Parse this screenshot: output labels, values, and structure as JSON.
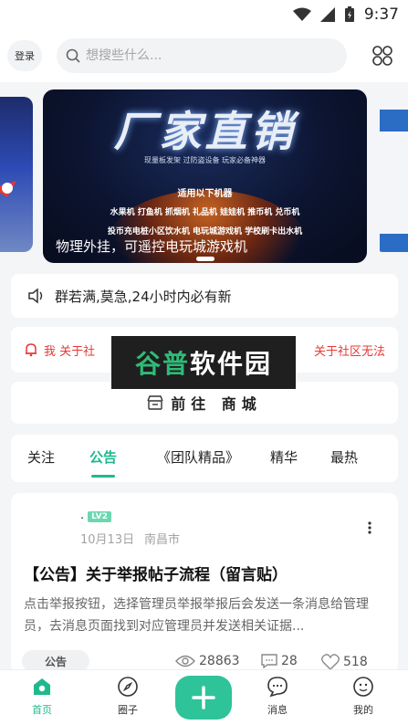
{
  "status_bar": {
    "time": "9:37"
  },
  "header": {
    "login_label": "登录",
    "search_placeholder": "想搜些什么..."
  },
  "banner": {
    "headline": "厂家直销",
    "tags": "现量板发架    过防盗设备    玩家必备神器",
    "grid_title": "适用以下机器",
    "grid_row1": "水果机  打鱼机  抓烟机  礼品机  娃娃机  推币机  兑币机",
    "grid_row2": "投币充电桩小区饮水机   电玩城游戏机   学校刷卡出水机",
    "caption": "物理外挂，可遥控电玩城游戏机"
  },
  "notice": {
    "text": "群若满,莫急,24小时内必有新"
  },
  "alert": {
    "text": "​​​​​​​​​​​​​​​​",
    "visible": "举报 关于社区无法...",
    "left_text": "我 关于社",
    "right_text": "关于社区无法"
  },
  "watermark": {
    "part1": "谷普",
    "part2": "软件园"
  },
  "mall": {
    "label": "前往 商城"
  },
  "tabs": [
    {
      "label": "关注"
    },
    {
      "label": "公告"
    },
    {
      "label": "《团队精品》"
    },
    {
      "label": "精华"
    },
    {
      "label": "最热"
    }
  ],
  "post": {
    "author": ".",
    "level": "LV2",
    "date": "10月13日",
    "location": "南昌市",
    "title": "【公告】关于举报帖子流程（留言贴）",
    "body": "点击举报按钮，选择管理员举报举报后会发送一条消息给管理员，去消息页面找到对应管理员并发送相关证据...",
    "tag": "公告",
    "views": "28863",
    "comments": "28",
    "likes": "518"
  },
  "bottom_nav": [
    {
      "label": "首页"
    },
    {
      "label": "圈子"
    },
    {
      "label": "消息"
    },
    {
      "label": "我的"
    }
  ],
  "colors": {
    "accent": "#1fb98e",
    "alert": "#e53935"
  }
}
